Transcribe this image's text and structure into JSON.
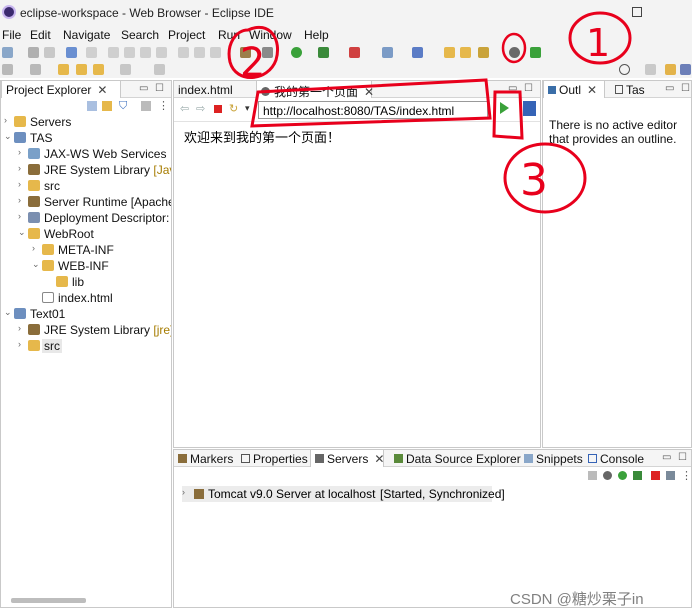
{
  "window": {
    "title": "eclipse-workspace - Web Browser - Eclipse IDE"
  },
  "menu": {
    "items": [
      "File",
      "Edit",
      "Navigate",
      "Search",
      "Project",
      "Run",
      "Window",
      "Help"
    ]
  },
  "project_explorer": {
    "tab_label": "Project Explorer",
    "tree": [
      {
        "label": "Servers",
        "decoration": ""
      },
      {
        "label": "TAS",
        "decoration": ""
      },
      {
        "label": "JAX-WS Web Services",
        "decoration": ""
      },
      {
        "label": "JRE System Library ",
        "decoration": "[JavaS"
      },
      {
        "label": "src",
        "decoration": ""
      },
      {
        "label": "Server Runtime [Apache",
        "decoration": ""
      },
      {
        "label": "Deployment Descriptor: ",
        "decoration": ""
      },
      {
        "label": "WebRoot",
        "decoration": ""
      },
      {
        "label": "META-INF",
        "decoration": ""
      },
      {
        "label": "WEB-INF",
        "decoration": ""
      },
      {
        "label": "lib",
        "decoration": ""
      },
      {
        "label": "index.html",
        "decoration": ""
      },
      {
        "label": "Text01",
        "decoration": ""
      },
      {
        "label": "JRE System Library ",
        "decoration": "[jre]"
      },
      {
        "label": "src",
        "decoration": ""
      }
    ]
  },
  "editor": {
    "tabs": [
      {
        "label": "index.html"
      },
      {
        "label": "我的第一个页面"
      }
    ],
    "url": "http://localhost:8080/TAS/index.html",
    "page_text": "欢迎来到我的第一个页面！"
  },
  "outline": {
    "tabs": [
      {
        "label": "Outl"
      },
      {
        "label": "Tas"
      }
    ],
    "message_line1": "There is no active editor",
    "message_line2": "that provides an outline."
  },
  "bottom": {
    "tabs": [
      {
        "label": "Markers"
      },
      {
        "label": "Properties"
      },
      {
        "label": "Servers"
      },
      {
        "label": "Data Source Explorer"
      },
      {
        "label": "Snippets"
      },
      {
        "label": "Console"
      }
    ],
    "server_entry": "Tomcat v9.0 Server at localhost",
    "server_status": "[Started, Synchronized]"
  },
  "annotations": [
    "1",
    "2",
    "3"
  ],
  "watermark": "CSDN @糖炒栗子in",
  "colors": {
    "annotation_red": "#e8001c",
    "run_green": "#3aa13a",
    "folder_yellow": "#e6b84b",
    "selection_gray": "#e8e8e8"
  }
}
